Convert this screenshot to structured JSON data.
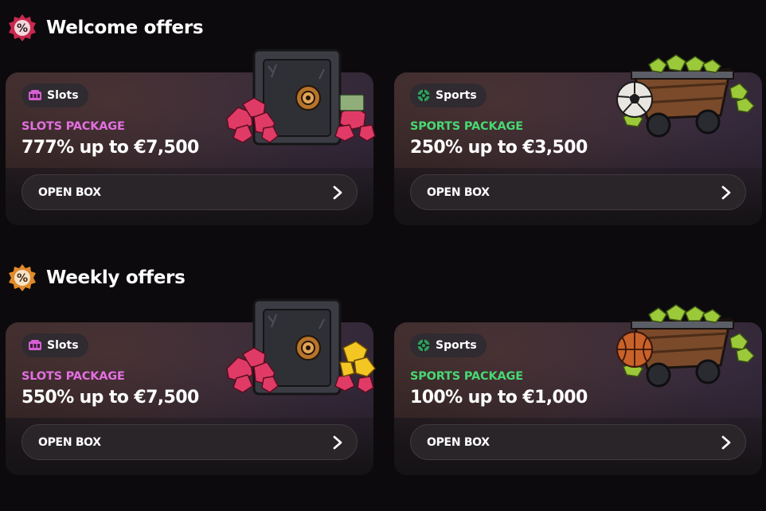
{
  "sections": [
    {
      "title": "Welcome offers",
      "icon": "percent-badge-icon",
      "icon_color": "#e0345b"
    },
    {
      "title": "Weekly offers",
      "icon": "percent-badge-icon",
      "icon_color": "#e08a2b"
    }
  ],
  "cards": [
    {
      "chip_label": "Slots",
      "chip_icon": "slot-machine-icon",
      "package_label": "SLOTS PACKAGE",
      "offer": "777% up to €7,500",
      "button_label": "OPEN BOX",
      "art": "safe-with-gems",
      "accent": "#e36fe0"
    },
    {
      "chip_label": "Sports",
      "chip_icon": "sports-icon",
      "package_label": "SPORTS PACKAGE",
      "offer": "250% up to €3,500",
      "button_label": "OPEN BOX",
      "art": "mine-cart-soccer-ball",
      "accent": "#48d873"
    },
    {
      "chip_label": "Slots",
      "chip_icon": "slot-machine-icon",
      "package_label": "SLOTS PACKAGE",
      "offer": "550% up to €7,500",
      "button_label": "OPEN BOX",
      "art": "safe-with-gems-gold",
      "accent": "#e36fe0"
    },
    {
      "chip_label": "Sports",
      "chip_icon": "sports-icon",
      "package_label": "SPORTS PACKAGE",
      "offer": "100% up to €1,000",
      "button_label": "OPEN BOX",
      "art": "mine-cart-basketball",
      "accent": "#48d873"
    }
  ]
}
